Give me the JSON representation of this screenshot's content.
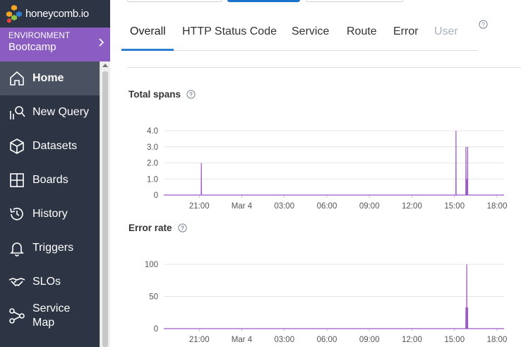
{
  "brand": {
    "logo_text": "honeycomb.io"
  },
  "environment": {
    "label": "ENVIRONMENT",
    "name": "Bootcamp"
  },
  "nav": [
    {
      "label": "Home",
      "icon": "home-icon",
      "active": true
    },
    {
      "label": "New Query",
      "icon": "query-icon"
    },
    {
      "label": "Datasets",
      "icon": "cube-icon"
    },
    {
      "label": "Boards",
      "icon": "boards-icon"
    },
    {
      "label": "History",
      "icon": "history-icon"
    },
    {
      "label": "Triggers",
      "icon": "bell-icon"
    },
    {
      "label": "SLOs",
      "icon": "handshake-icon"
    },
    {
      "label": "Service Map",
      "icon": "service-map-icon"
    }
  ],
  "tabs": [
    {
      "label": "Overall",
      "active": true
    },
    {
      "label": "HTTP Status Code"
    },
    {
      "label": "Service"
    },
    {
      "label": "Route"
    },
    {
      "label": "Error"
    },
    {
      "label": "User",
      "disabled": true
    }
  ],
  "colors": {
    "sidebar": "#2d3544",
    "environment": "#8b5cc2",
    "series": "#9b59c6",
    "tab_accent": "#2f7fd0"
  },
  "chart_data": [
    {
      "type": "line",
      "title": "Total spans",
      "x_ticks": [
        "21:00",
        "Mar 4",
        "03:00",
        "06:00",
        "09:00",
        "12:00",
        "15:00",
        "18:00"
      ],
      "y_ticks": [
        "0",
        "1.0",
        "2.0",
        "3.0",
        "4.0"
      ],
      "ylim": [
        0,
        4
      ],
      "xlim_hours": [
        18.5,
        42.5
      ],
      "grid": true,
      "series": [
        {
          "points": [
            [
              18.5,
              0
            ],
            [
              21.14,
              0
            ],
            [
              21.15,
              2
            ],
            [
              21.16,
              0
            ],
            [
              39.1,
              0
            ],
            [
              39.11,
              4
            ],
            [
              39.12,
              0
            ],
            [
              39.8,
              0
            ],
            [
              39.81,
              3
            ],
            [
              39.82,
              0
            ],
            [
              39.86,
              0
            ],
            [
              39.87,
              1
            ],
            [
              39.88,
              0
            ],
            [
              39.92,
              0
            ],
            [
              39.93,
              3
            ],
            [
              39.94,
              0
            ],
            [
              42.5,
              0
            ]
          ]
        }
      ]
    },
    {
      "type": "line",
      "title": "Error rate",
      "x_ticks": [
        "21:00",
        "Mar 4",
        "03:00",
        "06:00",
        "09:00",
        "12:00",
        "15:00",
        "18:00"
      ],
      "y_ticks": [
        "0",
        "50",
        "100"
      ],
      "ylim": [
        0,
        100
      ],
      "xlim_hours": [
        18.5,
        42.5
      ],
      "grid": true,
      "series": [
        {
          "points": [
            [
              18.5,
              0
            ],
            [
              39.8,
              0
            ],
            [
              39.81,
              33
            ],
            [
              39.82,
              0
            ],
            [
              39.86,
              0
            ],
            [
              39.87,
              100
            ],
            [
              39.88,
              0
            ],
            [
              39.92,
              0
            ],
            [
              39.93,
              33
            ],
            [
              39.94,
              0
            ],
            [
              42.5,
              0
            ]
          ]
        }
      ]
    }
  ]
}
